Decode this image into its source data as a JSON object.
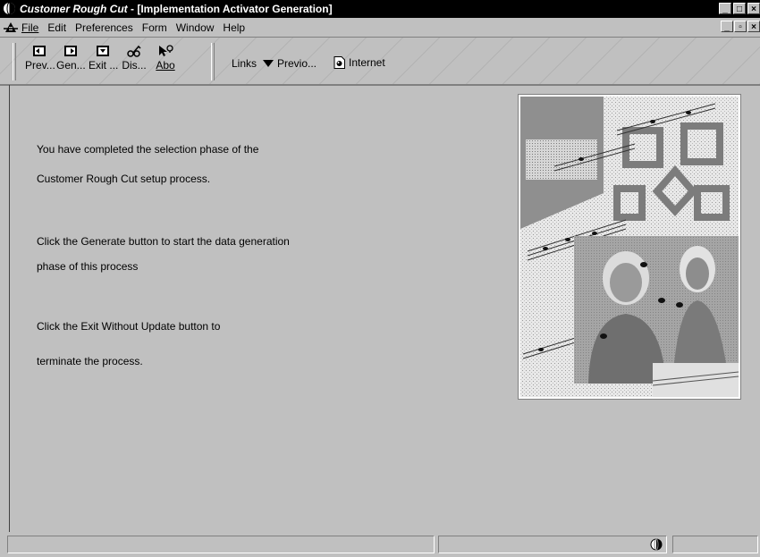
{
  "window": {
    "app_title": "Customer Rough Cut",
    "separator": " - ",
    "form_title": "[Implementation Activator Generation]",
    "controls": [
      "_",
      "□",
      "×"
    ]
  },
  "menubar": {
    "items": [
      "File",
      "Edit",
      "Preferences",
      "Form",
      "Window",
      "Help"
    ],
    "child_controls": [
      "_",
      "▫",
      "×"
    ]
  },
  "toolbar": {
    "buttons": [
      {
        "label": "Prev...",
        "icon": "prev-icon"
      },
      {
        "label": "Gen...",
        "icon": "generate-icon"
      },
      {
        "label": "Exit ...",
        "icon": "exit-icon"
      },
      {
        "label": "Dis...",
        "icon": "display-icon"
      },
      {
        "label": "Abo",
        "icon": "about-icon"
      }
    ],
    "links_label": "Links",
    "previous_label": "Previo...",
    "internet_label": "Internet"
  },
  "content": {
    "lines": [
      "You have completed the selection phase of the",
      "Customer Rough Cut setup process.",
      "Click the Generate button to start the data generation",
      "phase of this process",
      "Click the Exit Without Update button to",
      "terminate the process."
    ]
  }
}
